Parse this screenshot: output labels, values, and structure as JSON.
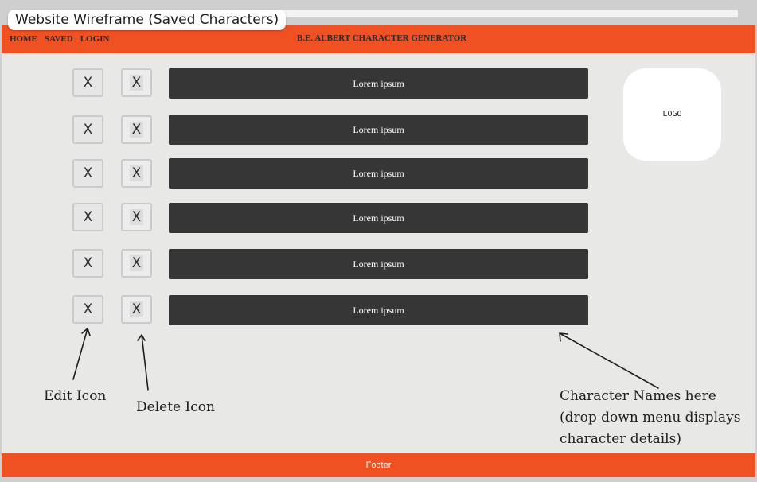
{
  "frame": {
    "title": "Website Wireframe (Saved Characters)"
  },
  "nav": {
    "links": [
      "HOME",
      "SAVED",
      "LOGIN"
    ],
    "site_title": "B.E. ALBERT CHARACTER GENERATOR"
  },
  "rows": [
    {
      "edit": "X",
      "delete": "X",
      "name": "Lorem ipsum"
    },
    {
      "edit": "X",
      "delete": "X",
      "name": "Lorem ipsum"
    },
    {
      "edit": "X",
      "delete": "X",
      "name": "Lorem ipsum"
    },
    {
      "edit": "X",
      "delete": "X",
      "name": "Lorem ipsum"
    },
    {
      "edit": "X",
      "delete": "X",
      "name": "Lorem ipsum"
    },
    {
      "edit": "X",
      "delete": "X",
      "name": "Lorem ipsum"
    }
  ],
  "logo": {
    "label": "LOGO"
  },
  "annotations": {
    "edit": "Edit Icon",
    "delete": "Delete Icon",
    "names": [
      "Character Names here",
      "(drop down menu displays",
      "character details)"
    ]
  },
  "footer": {
    "label": "Footer"
  },
  "colors": {
    "accent": "#f05123",
    "bar": "#363636",
    "canvas": "#e8e9e6"
  }
}
